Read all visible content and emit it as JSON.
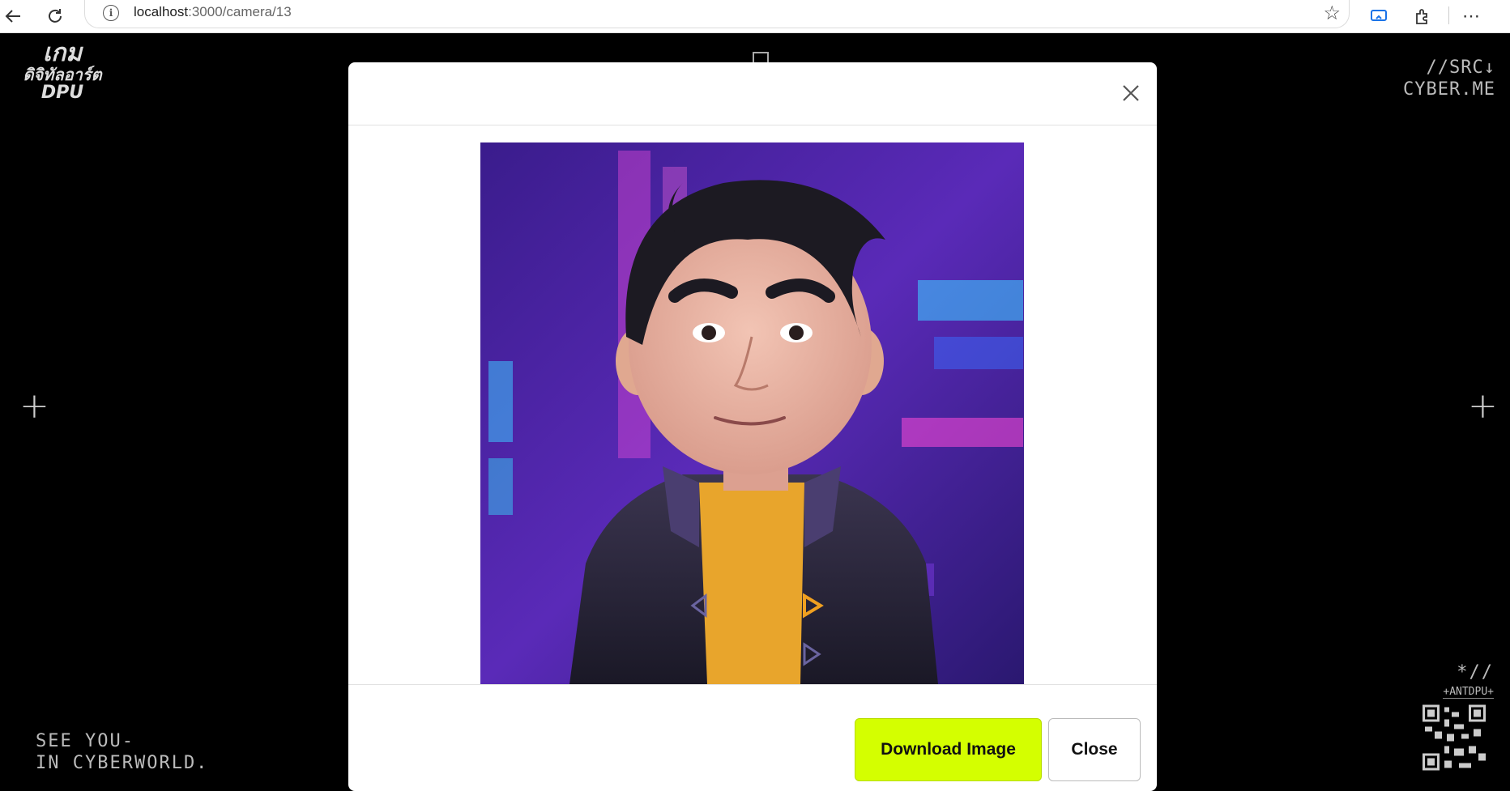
{
  "browser": {
    "url_host": "localhost",
    "url_rest": ":3000/camera/13",
    "icons": [
      "back-arrow-icon",
      "refresh-icon",
      "info-icon",
      "star-icon",
      "cast-icon",
      "extensions-icon",
      "more-icon"
    ]
  },
  "page": {
    "logo": {
      "line1": "เกม",
      "line2": "ดิจิทัลอาร์ต",
      "line3": "DPU"
    },
    "top_right": {
      "line1": "//SRC↓",
      "line2": "CYBER.ME"
    },
    "bottom_left": {
      "line1": "SEE YOU-",
      "line2": "IN CYBERWORLD."
    },
    "bottom_right": {
      "line1": "*//",
      "line2": "+ANTDPU+"
    },
    "accent_color": "#d4ff00"
  },
  "modal": {
    "download_label": "Download Image",
    "close_label": "Close",
    "image_alt": "cartoon avatar portrait"
  }
}
